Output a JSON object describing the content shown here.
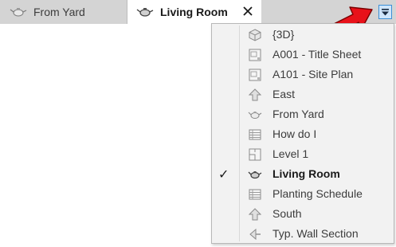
{
  "tabs": [
    {
      "label": "From Yard",
      "icon": "teapot-icon",
      "active": false
    },
    {
      "label": "Living Room",
      "icon": "teapot-icon",
      "active": true,
      "close_glyph": "✕"
    }
  ],
  "menu": {
    "items": [
      {
        "label": "{3D}",
        "icon": "3d-cube-icon",
        "checked": false
      },
      {
        "label": "A001 - Title Sheet",
        "icon": "sheet-icon",
        "checked": false
      },
      {
        "label": "A101 - Site Plan",
        "icon": "sheet-icon",
        "checked": false
      },
      {
        "label": "East",
        "icon": "elevation-icon",
        "checked": false
      },
      {
        "label": "From Yard",
        "icon": "teapot-icon",
        "checked": false
      },
      {
        "label": "How do I",
        "icon": "schedule-icon",
        "checked": false
      },
      {
        "label": "Level 1",
        "icon": "floor-plan-icon",
        "checked": false
      },
      {
        "label": "Living Room",
        "icon": "teapot-icon",
        "checked": true
      },
      {
        "label": "Planting Schedule",
        "icon": "schedule-icon",
        "checked": false
      },
      {
        "label": "South",
        "icon": "elevation-icon",
        "checked": false
      },
      {
        "label": "Typ. Wall Section",
        "icon": "section-icon",
        "checked": false
      }
    ],
    "check_glyph": "✓"
  },
  "colors": {
    "tab_strip": "#d4d4d4",
    "menu_background": "#f2f2f2",
    "dropdown_button": "#cfe6fb",
    "dropdown_border": "#3c8fd6",
    "callout_arrow": "#e8121a"
  }
}
